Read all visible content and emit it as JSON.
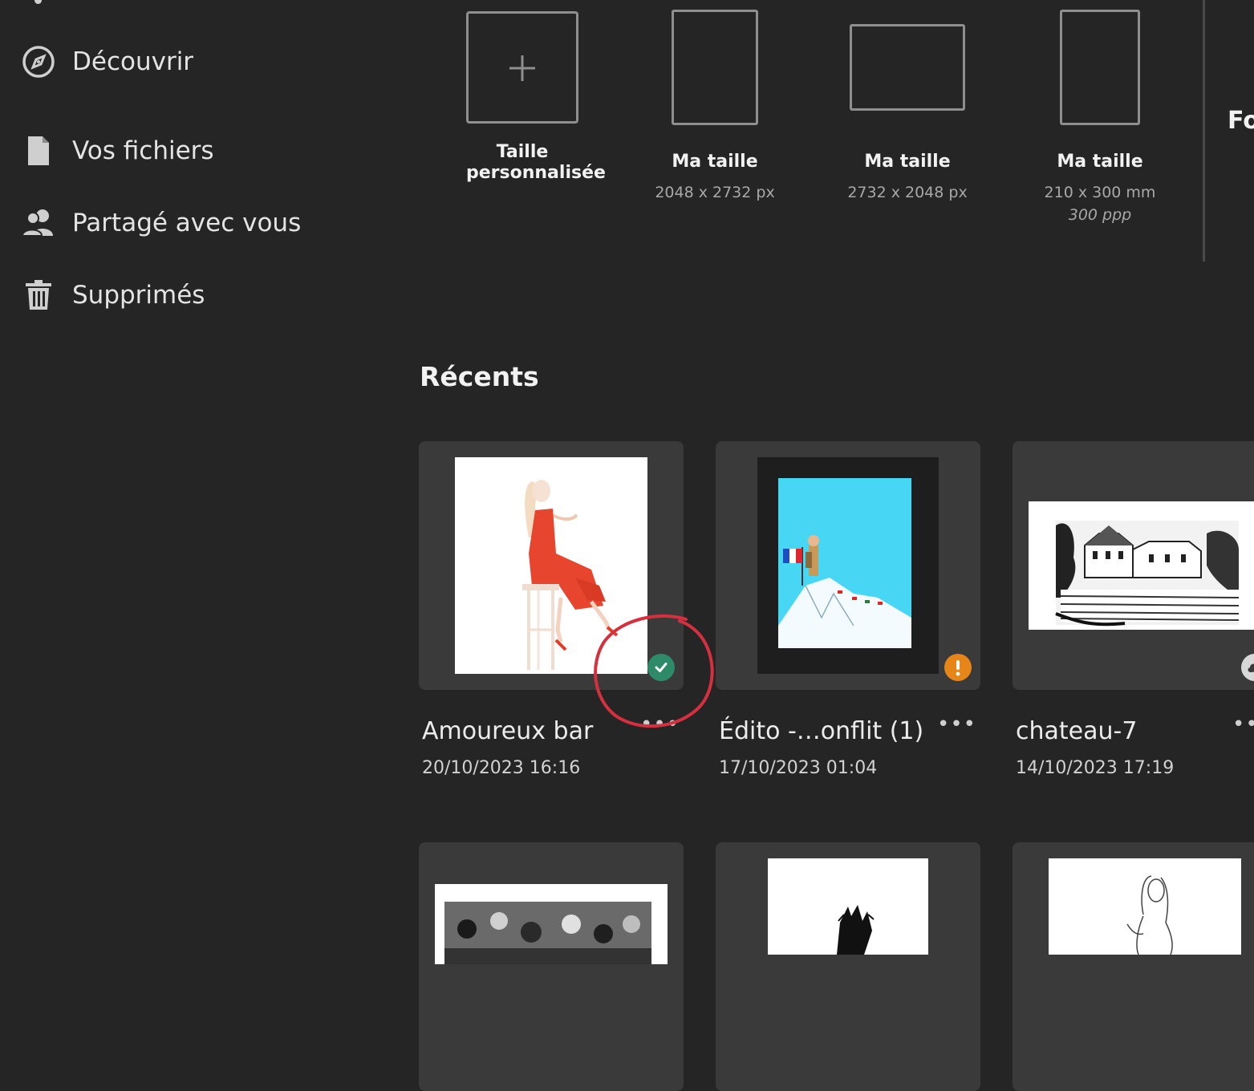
{
  "sidebar": {
    "items": [
      {
        "label": "Découvrir",
        "icon": "compass-icon"
      },
      {
        "label": "Vos fichiers",
        "icon": "file-icon"
      },
      {
        "label": "Partagé avec vous",
        "icon": "shared-users-icon"
      },
      {
        "label": "Supprimés",
        "icon": "trash-icon"
      }
    ]
  },
  "presets": [
    {
      "name": "Taille personnalisée",
      "icon": "plus-icon"
    },
    {
      "name": "Ma taille",
      "dims": "2048 x 2732 px"
    },
    {
      "name": "Ma taille",
      "dims": "2732 x 2048 px"
    },
    {
      "name": "Ma taille",
      "dims": "210 x 300 mm",
      "ppp": "300 ppp"
    }
  ],
  "cut_label": "Fo",
  "recents": {
    "title": "Récents",
    "items": [
      {
        "title": "Amoureux bar",
        "date": "20/10/2023 16:16",
        "status": "synced-check-icon"
      },
      {
        "title": "Édito -…onflit (1)",
        "date": "17/10/2023 01:04",
        "status": "warning-icon"
      },
      {
        "title": "chateau-7",
        "date": "14/10/2023 17:19",
        "status": "cloud-icon"
      }
    ]
  },
  "more_label": "•••",
  "colors": {
    "background": "#252525",
    "card": "#3a3a3a",
    "success": "#2e8b6a",
    "warning": "#e68619",
    "annotation": "#d6303f"
  }
}
